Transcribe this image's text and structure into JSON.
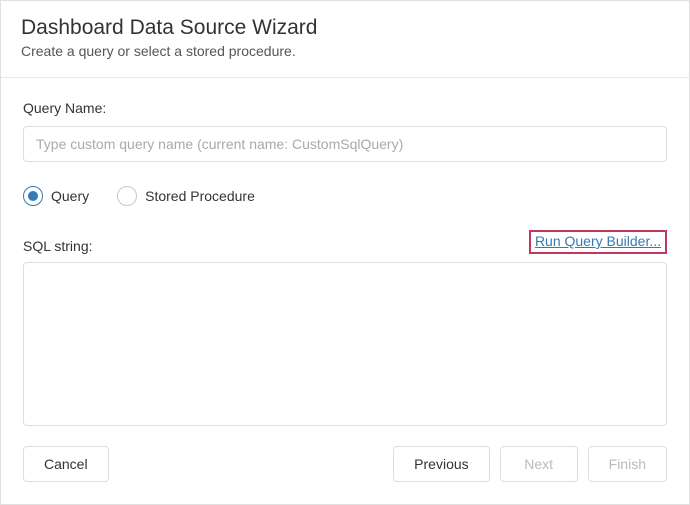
{
  "header": {
    "title": "Dashboard Data Source Wizard",
    "subtitle": "Create a query or select a stored procedure."
  },
  "queryName": {
    "label": "Query Name:",
    "value": "",
    "placeholder": "Type custom query name (current name: CustomSqlQuery)"
  },
  "queryType": {
    "options": {
      "query": "Query",
      "storedProcedure": "Stored Procedure"
    },
    "selected": "query"
  },
  "sql": {
    "label": "SQL string:",
    "runQueryBuilder": "Run Query Builder...",
    "value": ""
  },
  "footer": {
    "cancel": "Cancel",
    "previous": "Previous",
    "next": "Next",
    "finish": "Finish"
  }
}
